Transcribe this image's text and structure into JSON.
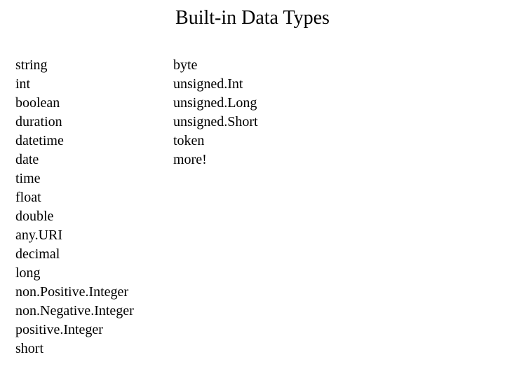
{
  "title": "Built-in Data Types",
  "columns": {
    "left": [
      "string",
      "int",
      "boolean",
      "duration",
      "datetime",
      "date",
      "time",
      "float",
      "double",
      "any.URI",
      "decimal",
      "long",
      "non.Positive.Integer",
      "non.Negative.Integer",
      "positive.Integer",
      "short"
    ],
    "right": [
      "byte",
      "unsigned.Int",
      "unsigned.Long",
      "unsigned.Short",
      "token",
      "more!"
    ]
  }
}
